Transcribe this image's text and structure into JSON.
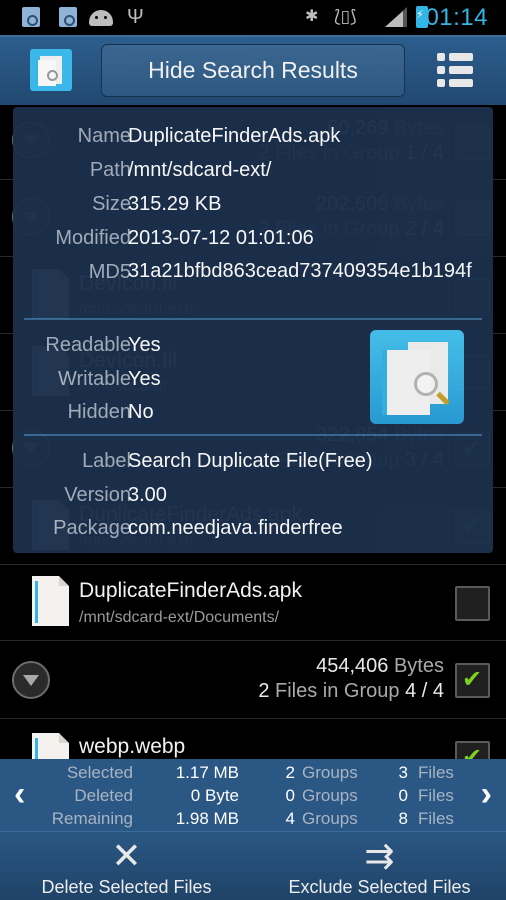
{
  "status_bar": {
    "time": "01:14",
    "left_icons": [
      "app-notification-icon",
      "app-notification-icon",
      "android-icon",
      "usb-icon"
    ],
    "right_icons": [
      "bluetooth-icon",
      "vibrate-icon",
      "signal-icon",
      "battery-charging-icon"
    ]
  },
  "action_bar": {
    "app_icon": "duplicate-finder-app-icon",
    "hide_button_label": "Hide Search Results",
    "menu_icon": "list-menu-icon"
  },
  "background_list": {
    "groups": [
      {
        "bytes": "60,269",
        "bytes_unit": "Bytes",
        "files": "2",
        "files_text": "Files in Group",
        "group": "1 / 4",
        "checked": false,
        "expanded": false
      },
      {
        "bytes": "202,506",
        "bytes_unit": "Bytes",
        "files": "2",
        "files_text": "Files in Group",
        "group": "2 / 4",
        "checked": false,
        "expanded": true
      },
      {
        "bytes": "322,854",
        "bytes_unit": "Bytes",
        "files": "2",
        "files_text": "Files in Group",
        "group": "3 / 4",
        "checked": true,
        "expanded": true
      },
      {
        "bytes": "454,406",
        "bytes_unit": "Bytes",
        "files": "2",
        "files_text": "Files in Group",
        "group": "4 / 4",
        "checked": true,
        "expanded": true
      }
    ],
    "files": [
      {
        "name": "DevIcon.fil",
        "path": "/mnt/sdcard-ext/",
        "checked": false
      },
      {
        "name": "DevIcon.fil",
        "path": "/mnt/sdcard/",
        "checked": false
      },
      {
        "name": "DuplicateFinderAds.apk",
        "path": "/mnt/sdcard-ext/",
        "checked": true
      },
      {
        "name": "DuplicateFinderAds.apk",
        "path": "/mnt/sdcard-ext/Documents/",
        "checked": false
      },
      {
        "name": "webp.webp",
        "path": "",
        "checked": true
      }
    ]
  },
  "info_card": {
    "file_info": [
      {
        "label": "Name",
        "value": "DuplicateFinderAds.apk"
      },
      {
        "label": "Path",
        "value": "/mnt/sdcard-ext/"
      },
      {
        "label": "Size",
        "value": "315.29 KB"
      },
      {
        "label": "Modified",
        "value": "2013-07-12 01:01:06"
      },
      {
        "label": "MD5",
        "value": "31a21bfbd863cead737409354e1b194f"
      }
    ],
    "attributes": [
      {
        "label": "Readable",
        "value": "Yes"
      },
      {
        "label": "Writable",
        "value": "Yes"
      },
      {
        "label": "Hidden",
        "value": "No"
      }
    ],
    "app_info": [
      {
        "label": "Label",
        "value": "Search Duplicate File(Free)"
      },
      {
        "label": "Version",
        "value": "3.00"
      },
      {
        "label": "Package",
        "value": "com.needjava.finderfree"
      }
    ],
    "icon": "duplicate-finder-app-icon"
  },
  "summary": {
    "rows": [
      {
        "label": "Selected",
        "size": "1.17 MB",
        "groups": "2",
        "groups_label": "Groups",
        "files": "3",
        "files_label": "Files"
      },
      {
        "label": "Deleted",
        "size": "0 Byte",
        "groups": "0",
        "groups_label": "Groups",
        "files": "0",
        "files_label": "Files"
      },
      {
        "label": "Remaining",
        "size": "1.98 MB",
        "groups": "4",
        "groups_label": "Groups",
        "files": "8",
        "files_label": "Files"
      }
    ],
    "prev_icon": "‹",
    "next_icon": "›"
  },
  "bottom_bar": {
    "delete_label": "Delete Selected Files",
    "exclude_label": "Exclude Selected Files",
    "delete_icon": "✕",
    "exclude_icon": "⇉"
  },
  "colors": {
    "accent": "#33b5e5",
    "action_bar": "#2d5e8e",
    "info_card_bg": "#1c304c",
    "summary_bg": "#2b5785",
    "check_green": "#7ed321"
  }
}
